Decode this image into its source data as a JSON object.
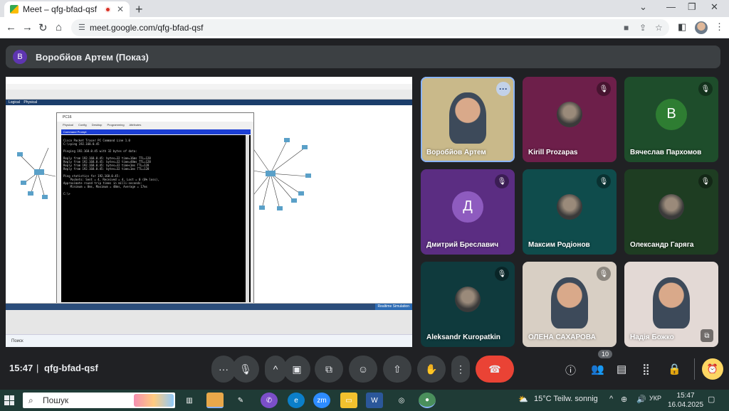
{
  "browser": {
    "tab_title": "Meet – qfg-bfad-qsf",
    "url": "meet.google.com/qfg-bfad-qsf"
  },
  "presenter": {
    "avatar_letter": "В",
    "label": "Воробйов Артем (Показ)"
  },
  "shared_screen": {
    "window_title": "PC16",
    "tabs": [
      "Physical",
      "Config",
      "Desktop",
      "Programming",
      "Attributes"
    ],
    "panel_title": "Command Prompt",
    "terminal_lines": [
      "Cisco Packet Tracer PC Command Line 1.0",
      "C:\\>ping 192.168.0.45",
      "",
      "Pinging 192.168.0.45 with 32 bytes of data:",
      "",
      "Reply from 192.168.0.45: bytes=32 time=16ms TTL=128",
      "Reply from 192.168.0.45: bytes=32 time=48ms TTL=128",
      "Reply from 192.168.0.45: bytes=32 time<1ms TTL=128",
      "Reply from 192.168.0.45: bytes=32 time=1ms TTL=128",
      "",
      "Ping statistics for 192.168.0.45:",
      "    Packets: Sent = 4, Received = 4, Lost = 0 (0% loss),",
      "Approximate round trip times in milli-seconds:",
      "    Minimum = 0ms, Maximum = 48ms, Average = 17ms",
      "",
      "C:\\>"
    ],
    "logical_tab": "Logical",
    "physical_tab": "Physical",
    "realtime_label": "Realtime",
    "simulation_label": "Simulation",
    "taskbar_search": "Поиск"
  },
  "participants": [
    {
      "name": "Воробйов Артем",
      "type": "video",
      "muted": false,
      "bg": "#c9b98a"
    },
    {
      "name": "Kirill Prozapas",
      "type": "photo",
      "muted": true,
      "bg": "#6d1f4a"
    },
    {
      "name": "Вячеслав Пархомов",
      "type": "letter",
      "letter": "В",
      "muted": true,
      "bg": "#1e4d2b",
      "letter_bg": "#2e7d32"
    },
    {
      "name": "Дмитрий Бреславич",
      "type": "letter",
      "letter": "Д",
      "muted": true,
      "bg": "#5b2d82",
      "letter_bg": "#8e5bbf"
    },
    {
      "name": "Максим Родіонов",
      "type": "photo",
      "muted": true,
      "bg": "#0f4c4c"
    },
    {
      "name": "Олександр Гаряга",
      "type": "photo",
      "muted": true,
      "bg": "#1e3d22"
    },
    {
      "name": "Aleksandr Kuropatkin",
      "type": "photo",
      "muted": true,
      "bg": "#0f3a3d"
    },
    {
      "name": "ОЛЕНА САХАРОВА",
      "type": "video",
      "muted": true,
      "bg": "#d8cfc4"
    },
    {
      "name": "Надія Божко",
      "type": "video",
      "muted": false,
      "bg": "#e3d9d5"
    }
  ],
  "controls": {
    "time": "15:47",
    "separator": "|",
    "meeting_code": "qfg-bfad-qsf",
    "participant_count": "10"
  },
  "taskbar": {
    "search_placeholder": "Пошук",
    "weather": "15°C  Teilw. sonnig",
    "lang": "УКР",
    "clock_time": "15:47",
    "clock_date": "16.04.2025"
  }
}
